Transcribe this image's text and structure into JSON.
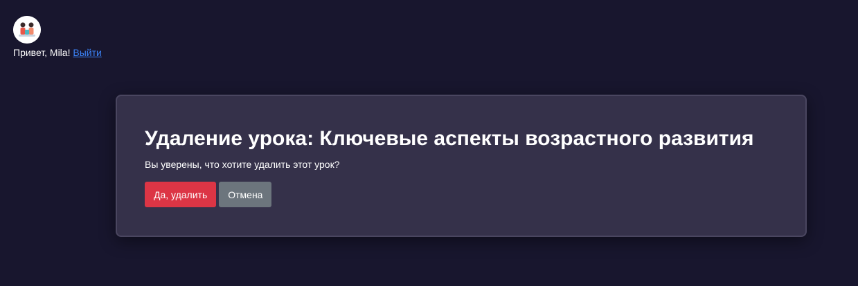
{
  "header": {
    "avatar_icon": "user-illustration-icon",
    "greeting": "Привет, Mila!",
    "logout_label": "Выйти"
  },
  "dialog": {
    "title": "Удаление урока: Ключевые аспекты возрастного развития",
    "message": "Вы уверены, что хотите удалить этот урок?",
    "confirm_label": "Да, удалить",
    "cancel_label": "Отмена"
  },
  "colors": {
    "background": "#18162e",
    "card": "#35314a",
    "danger": "#dc3545",
    "secondary": "#6c757d",
    "link": "#3b82f6"
  }
}
